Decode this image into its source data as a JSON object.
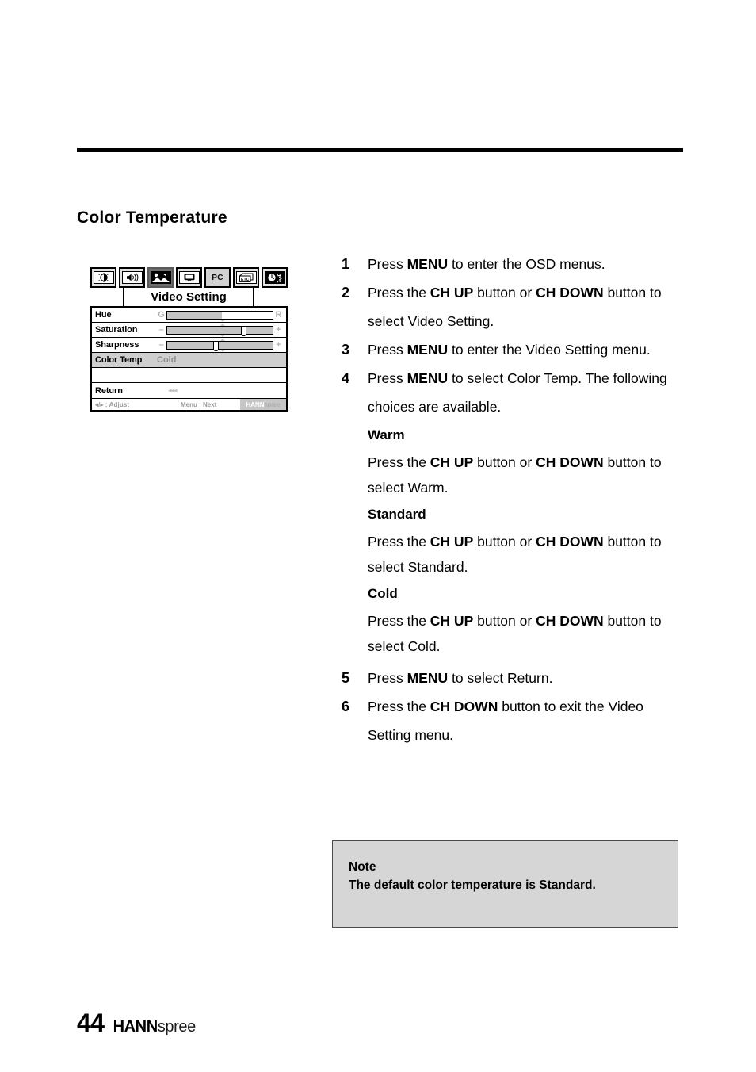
{
  "page": {
    "heading": "Color Temperature",
    "number": "44",
    "brand_bold": "HANN",
    "brand_light": "spree"
  },
  "osd": {
    "icons": [
      {
        "name": "brightness-contrast-icon",
        "label": ""
      },
      {
        "name": "audio-speaker-icon",
        "label": ""
      },
      {
        "name": "video-picture-icon",
        "label": "",
        "selected": true
      },
      {
        "name": "screen-display-icon",
        "label": ""
      },
      {
        "name": "pc-mode-icon",
        "label": "PC"
      },
      {
        "name": "etc-settings-icon",
        "label": ""
      },
      {
        "name": "timer-sleep-icon",
        "label": ""
      }
    ],
    "title": "Video Setting",
    "rows": [
      {
        "label": "Hue",
        "type": "slider",
        "left_mark": "G",
        "right_mark": "R",
        "fill": 52,
        "thumb": null
      },
      {
        "label": "Saturation",
        "type": "slider",
        "left_mark": "–",
        "right_mark": "+",
        "fill": 100,
        "thumb": 72
      },
      {
        "label": "Sharpness",
        "type": "slider",
        "left_mark": "–",
        "right_mark": "+",
        "fill": 100,
        "thumb": 46
      },
      {
        "label": "Color Temp",
        "type": "value",
        "value": "Cold",
        "highlight": true
      },
      {
        "label": "",
        "type": "blank"
      },
      {
        "label": "Return",
        "type": "return",
        "arrows": "◂◂◂"
      }
    ],
    "footer": {
      "adjust": "◂/▸ : Adjust",
      "next": "Menu : Next",
      "brand_bold": "HANN",
      "brand_light": "spree"
    }
  },
  "steps": [
    {
      "num": "1",
      "parts": [
        {
          "t": "Press "
        },
        {
          "t": "MENU",
          "b": true
        },
        {
          "t": " to enter the OSD menus."
        }
      ]
    },
    {
      "num": "2",
      "parts": [
        {
          "t": "Press the "
        },
        {
          "t": "CH UP",
          "b": true
        },
        {
          "t": " button or "
        },
        {
          "t": "CH DOWN",
          "b": true
        },
        {
          "t": " button to select Video Setting."
        }
      ]
    },
    {
      "num": "3",
      "parts": [
        {
          "t": "Press "
        },
        {
          "t": "MENU",
          "b": true
        },
        {
          "t": " to enter the Video Setting menu."
        }
      ]
    },
    {
      "num": "4",
      "parts": [
        {
          "t": "Press "
        },
        {
          "t": "MENU",
          "b": true
        },
        {
          "t": " to select Color Temp. The following choices are available."
        }
      ]
    }
  ],
  "choices": [
    {
      "title": "Warm",
      "parts": [
        {
          "t": "Press the "
        },
        {
          "t": "CH UP",
          "b": true
        },
        {
          "t": " button or "
        },
        {
          "t": "CH DOWN",
          "b": true
        },
        {
          "t": " button to select Warm."
        }
      ]
    },
    {
      "title": "Standard",
      "parts": [
        {
          "t": "Press the "
        },
        {
          "t": "CH UP",
          "b": true
        },
        {
          "t": " button or "
        },
        {
          "t": "CH DOWN",
          "b": true
        },
        {
          "t": " button to select Standard."
        }
      ]
    },
    {
      "title": "Cold",
      "parts": [
        {
          "t": "Press the "
        },
        {
          "t": "CH UP",
          "b": true
        },
        {
          "t": " button or "
        },
        {
          "t": "CH DOWN",
          "b": true
        },
        {
          "t": " button to select Cold."
        }
      ]
    }
  ],
  "steps_tail": [
    {
      "num": "5",
      "parts": [
        {
          "t": "Press "
        },
        {
          "t": "MENU",
          "b": true
        },
        {
          "t": " to select Return."
        }
      ]
    },
    {
      "num": "6",
      "parts": [
        {
          "t": "Press the "
        },
        {
          "t": "CH DOWN",
          "b": true
        },
        {
          "t": " button to exit the Video Setting menu."
        }
      ]
    }
  ],
  "note": {
    "title": "Note",
    "text": "The default color temperature is Standard."
  }
}
